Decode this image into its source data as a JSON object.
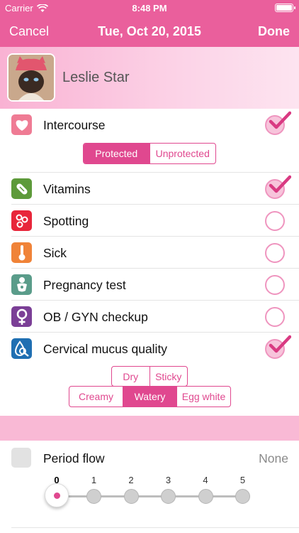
{
  "status_bar": {
    "carrier": "Carrier",
    "time": "8:48 PM"
  },
  "nav": {
    "cancel": "Cancel",
    "title": "Tue, Oct 20, 2015",
    "done": "Done"
  },
  "profile": {
    "name": "Leslie Star"
  },
  "rows": {
    "intercourse": {
      "label": "Intercourse",
      "checked": true,
      "icon": "heart-icon",
      "color": "#ef7b94"
    },
    "vitamins": {
      "label": "Vitamins",
      "checked": true,
      "icon": "pill-icon",
      "color": "#5d9a3a"
    },
    "spotting": {
      "label": "Spotting",
      "checked": false,
      "icon": "spots-icon",
      "color": "#e8263a"
    },
    "sick": {
      "label": "Sick",
      "checked": false,
      "icon": "thermometer-icon",
      "color": "#f08338"
    },
    "pregnancy_test": {
      "label": "Pregnancy test",
      "checked": false,
      "icon": "baby-icon",
      "color": "#5a9c8a"
    },
    "obgyn": {
      "label": "OB / GYN checkup",
      "checked": false,
      "icon": "female-symbol-icon",
      "color": "#7b3f96"
    },
    "cervical": {
      "label": "Cervical mucus quality",
      "checked": true,
      "icon": "drop-magnifier-icon",
      "color": "#1f6fb2"
    }
  },
  "intercourse_options": {
    "protected": "Protected",
    "unprotected": "Unprotected",
    "selected": "Protected"
  },
  "mucus_options": {
    "row1": [
      "Dry",
      "Sticky"
    ],
    "row2": [
      "Creamy",
      "Watery",
      "Egg white"
    ],
    "selected": "Watery"
  },
  "period_flow": {
    "label": "Period flow",
    "value": "None",
    "levels": [
      "0",
      "1",
      "2",
      "3",
      "4",
      "5"
    ],
    "selected_level": 0
  },
  "colors": {
    "accent": "#e0488f",
    "nav_bg": "#ea5f9c",
    "band": "#f9b9d5"
  }
}
